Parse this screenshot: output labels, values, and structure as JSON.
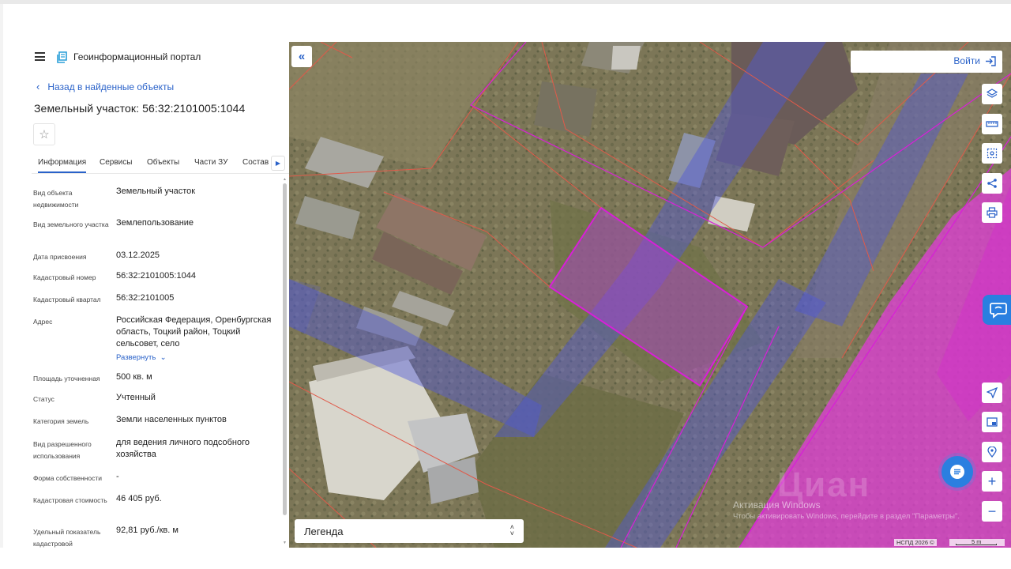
{
  "header": {
    "portal_title": "Геоинформационный портал"
  },
  "nav": {
    "back_label": "Назад в найденные объекты"
  },
  "object": {
    "title": "Земельный участок: 56:32:2101005:1044"
  },
  "tabs": [
    {
      "label": "Информация",
      "active": true
    },
    {
      "label": "Сервисы"
    },
    {
      "label": "Объекты"
    },
    {
      "label": "Части ЗУ"
    },
    {
      "label": "Состав"
    }
  ],
  "details": [
    {
      "label": "Вид объекта недвижимости",
      "value": "Земельный участок"
    },
    {
      "label": "Вид земельного участка",
      "value": "Землепользование"
    },
    {
      "label": "Дата присвоения",
      "value": "03.12.2025"
    },
    {
      "label": "Кадастровый номер",
      "value": "56:32:2101005:1044"
    },
    {
      "label": "Кадастровый квартал",
      "value": "56:32:2101005"
    },
    {
      "label": "Адрес",
      "value": "Российская Федерация, Оренбургская область, Тоцкий район, Тоцкий сельсовет, село",
      "expand_label": "Развернуть"
    },
    {
      "label": "Площадь уточненная",
      "value": "500 кв. м"
    },
    {
      "label": "Статус",
      "value": "Учтенный"
    },
    {
      "label": "Категория земель",
      "value": "Земли населенных пунктов"
    },
    {
      "label": "Вид разрешенного использования",
      "value": "для ведения личного подсобного хозяйства"
    },
    {
      "label": "Форма собственности",
      "value": "-"
    },
    {
      "label": "Кадастровая стоимость",
      "value": "46 405 руб."
    },
    {
      "label": "Удельный показатель кадастровой",
      "value": "92,81 руб./кв. м"
    }
  ],
  "map": {
    "login_label": "Войти",
    "legend_label": "Легенда",
    "attribution": "НСПД 2026 ©",
    "scale_label": "5 m",
    "watermark_title": "Активация Windows",
    "watermark_text": "Чтобы активировать Windows, перейдите в раздел \"Параметры\".",
    "brand_watermark": "Циан"
  },
  "colors": {
    "accent": "#2a62c9",
    "parcel_outline": "#d81fd8",
    "zone_blue": "#4f58d8",
    "zone_magenta": "#e23ed8"
  },
  "icons": {
    "menu": "hamburger-icon",
    "logo": "portal-logo-icon",
    "favorite": "star-icon",
    "collapse": "double-chevron-left-icon",
    "login": "login-arrow-icon",
    "tools": [
      "layers-icon",
      "ruler-icon",
      "select-area-icon",
      "share-icon",
      "print-icon",
      "locate-icon",
      "minimap-icon",
      "location-pin-icon",
      "zoom-in-icon",
      "zoom-out-icon"
    ],
    "chat": "chat-icon"
  }
}
